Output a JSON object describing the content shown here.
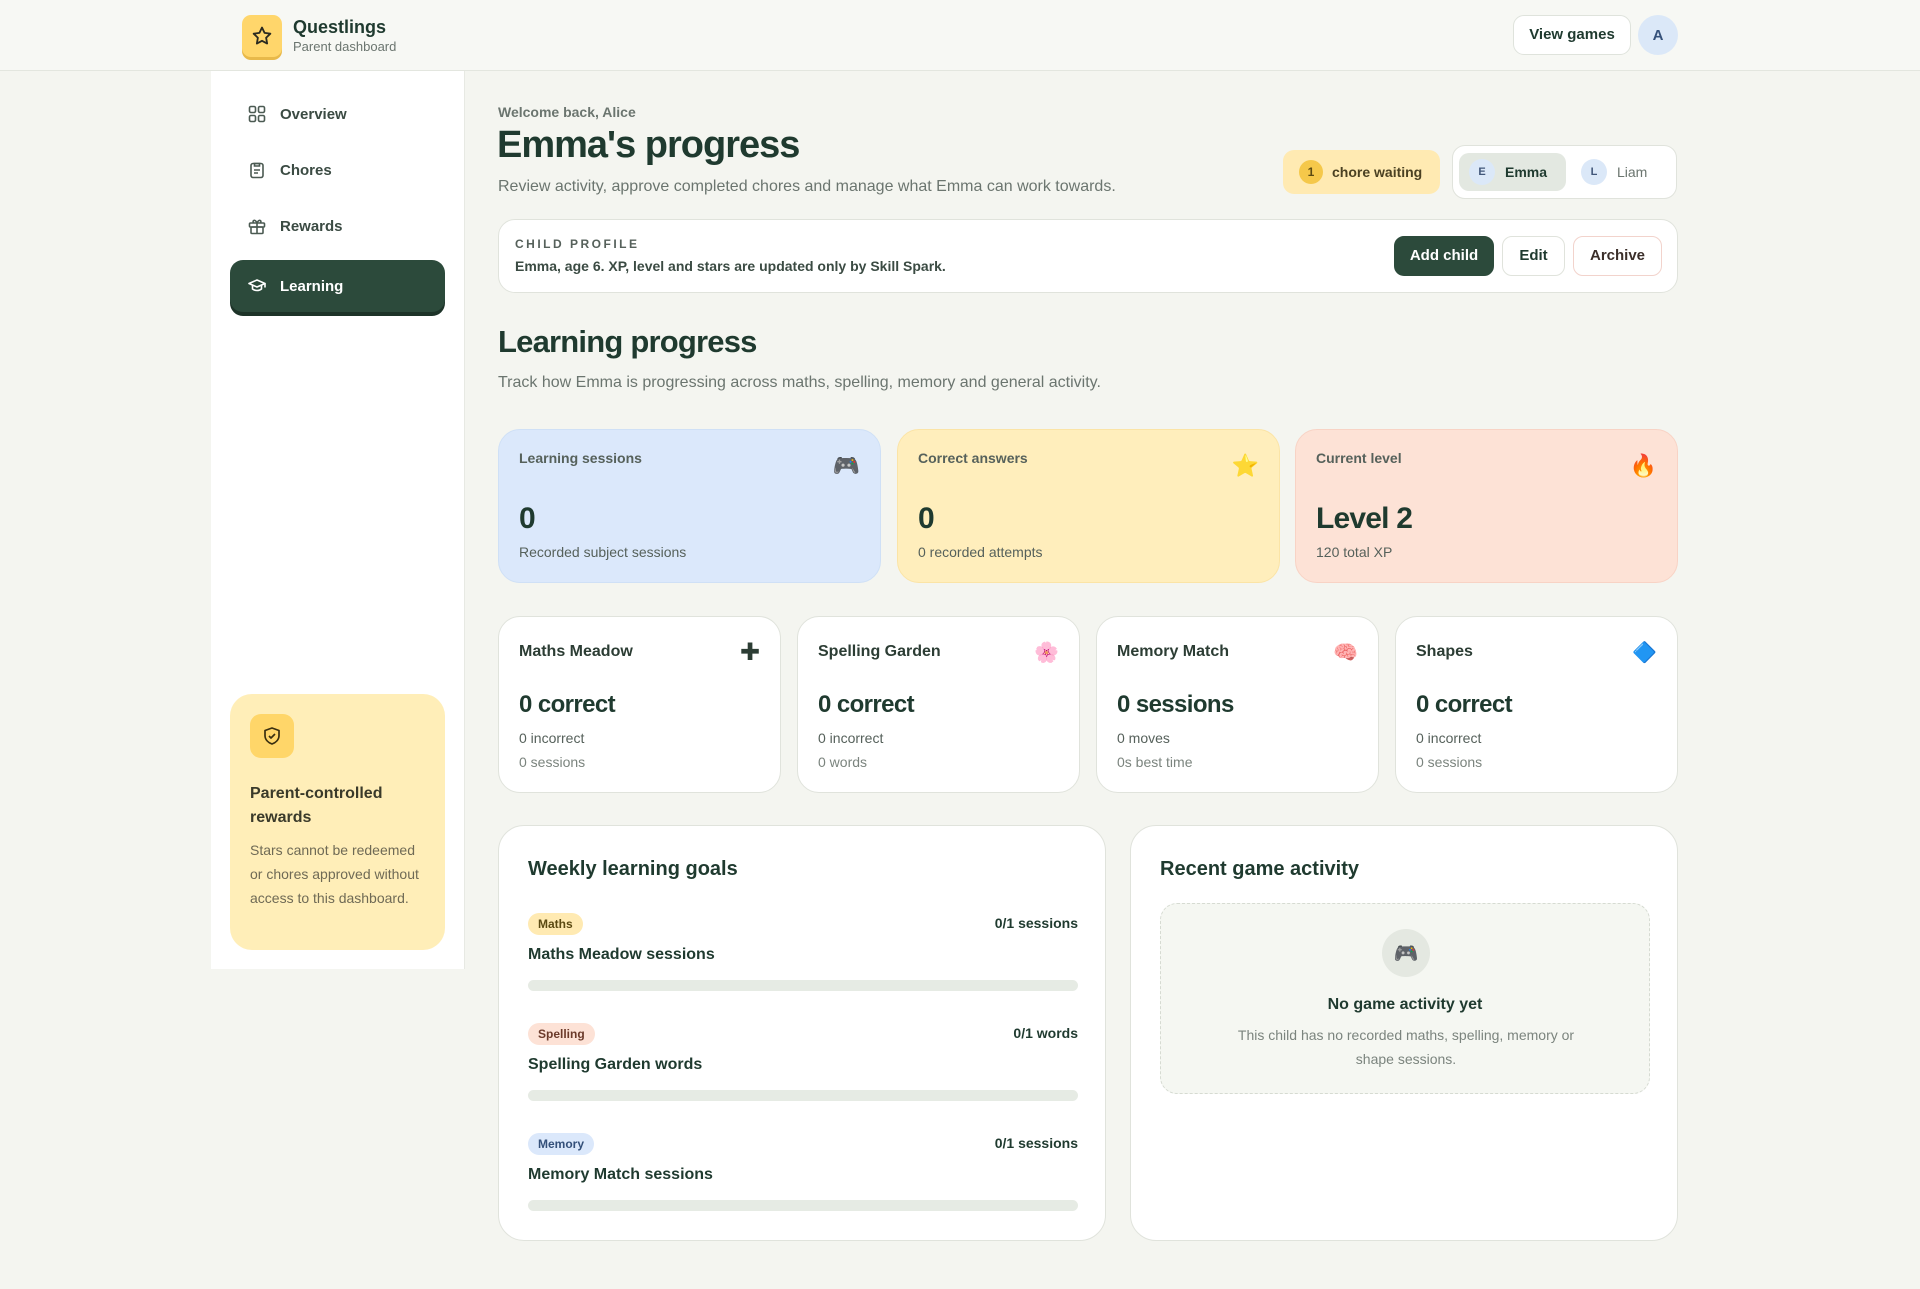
{
  "header": {
    "brand_name": "Questlings",
    "brand_sub": "Parent dashboard",
    "view_games_label": "View games",
    "avatar_initial": "A"
  },
  "sidebar": {
    "items": [
      {
        "label": "Overview",
        "icon": "grid-icon"
      },
      {
        "label": "Chores",
        "icon": "clipboard-icon"
      },
      {
        "label": "Rewards",
        "icon": "gift-icon"
      },
      {
        "label": "Learning",
        "icon": "graduation-cap-icon",
        "active": true
      }
    ],
    "info_card": {
      "icon": "shield-check-icon",
      "title": "Parent-controlled rewards",
      "body": "Stars cannot be redeemed or chores approved without access to this dashboard."
    }
  },
  "main": {
    "welcome": "Welcome back, Alice",
    "title": "Emma's progress",
    "subtitle": "Review activity, approve completed chores and manage what Emma can work towards.",
    "chore_pill": {
      "count": "1",
      "text": "chore waiting"
    },
    "children": [
      {
        "initial": "E",
        "name": "Emma",
        "selected": true
      },
      {
        "initial": "L",
        "name": "Liam",
        "selected": false
      }
    ],
    "profile": {
      "label": "CHILD PROFILE",
      "desc": "Emma, age 6. XP, level and stars are updated only by Skill Spark.",
      "add_label": "Add child",
      "edit_label": "Edit",
      "archive_label": "Archive"
    },
    "section_title": "Learning progress",
    "section_sub": "Track how Emma is progressing across maths, spelling, memory and general activity.",
    "stats": [
      {
        "label": "Learning sessions",
        "icon": "🎮",
        "value": "0",
        "note": "Recorded subject sessions"
      },
      {
        "label": "Correct answers",
        "icon": "⭐",
        "value": "0",
        "note": "0 recorded attempts"
      },
      {
        "label": "Current level",
        "icon": "🔥",
        "value": "Level 2",
        "note": "120 total XP"
      }
    ],
    "subjects": [
      {
        "name": "Maths Meadow",
        "icon": "✚",
        "main": "0 correct",
        "line1": "0 incorrect",
        "line2": "0 sessions"
      },
      {
        "name": "Spelling Garden",
        "icon": "🌸",
        "main": "0 correct",
        "line1": "0 incorrect",
        "line2": "0 words"
      },
      {
        "name": "Memory Match",
        "icon": "🧠",
        "main": "0 sessions",
        "line1": "0 moves",
        "line2": "0s best time"
      },
      {
        "name": "Shapes",
        "icon": "🔷",
        "main": "0 correct",
        "line1": "0 incorrect",
        "line2": "0 sessions"
      }
    ],
    "goals": {
      "title": "Weekly learning goals",
      "items": [
        {
          "tag": "Maths",
          "tag_bg": "#ffeab2",
          "tag_color": "#5b4a12",
          "name": "Maths Meadow sessions",
          "count": "0/1 sessions",
          "progress": 0
        },
        {
          "tag": "Spelling",
          "tag_bg": "#fde2d6",
          "tag_color": "#6b3a2a",
          "name": "Spelling Garden words",
          "count": "0/1 words",
          "progress": 0
        },
        {
          "tag": "Memory",
          "tag_bg": "#dbe8fb",
          "tag_color": "#34507a",
          "name": "Memory Match sessions",
          "count": "0/1 sessions",
          "progress": 0
        }
      ]
    },
    "activity": {
      "title": "Recent game activity",
      "icon": "🎮",
      "empty_title": "No game activity yet",
      "empty_desc": "This child has no recorded maths, spelling, memory or shape sessions."
    }
  },
  "colors": {
    "accent_dark_green": "#2c4a3b",
    "brand_yellow": "#ffd66b",
    "stat_blue": "#dbe8fb",
    "stat_yellow": "#ffeebc",
    "stat_pink": "#fde2d6"
  }
}
